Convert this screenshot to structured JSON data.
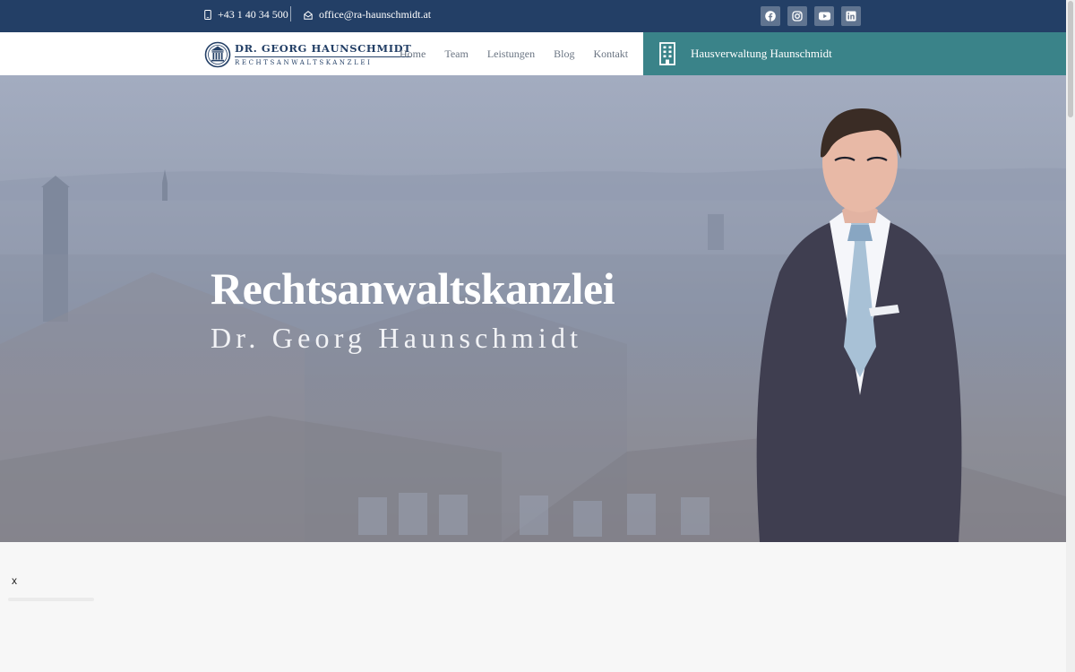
{
  "topbar": {
    "phone": "+43 1 40 34 500",
    "email": "office@ra-haunschmidt.at",
    "social": [
      {
        "name": "facebook-icon"
      },
      {
        "name": "instagram-icon"
      },
      {
        "name": "youtube-icon"
      },
      {
        "name": "linkedin-icon"
      }
    ]
  },
  "navbar": {
    "logo": {
      "title": "DR. GEORG HAUNSCHMIDT",
      "subtitle": "RECHTSANWALTSKANZLEI"
    },
    "items": [
      {
        "label": "Home"
      },
      {
        "label": "Team"
      },
      {
        "label": "Leistungen"
      },
      {
        "label": "Blog"
      },
      {
        "label": "Kontakt"
      }
    ],
    "cta": {
      "label": "Hausverwaltung Haunschmidt"
    }
  },
  "hero": {
    "title": "Rechtsanwaltskanzlei",
    "subtitle": "Dr. Georg Haunschmidt"
  },
  "popup": {
    "close_label": "x"
  },
  "colors": {
    "navy": "#233f66",
    "teal": "#3a8389",
    "background": "#f7f7f7"
  }
}
